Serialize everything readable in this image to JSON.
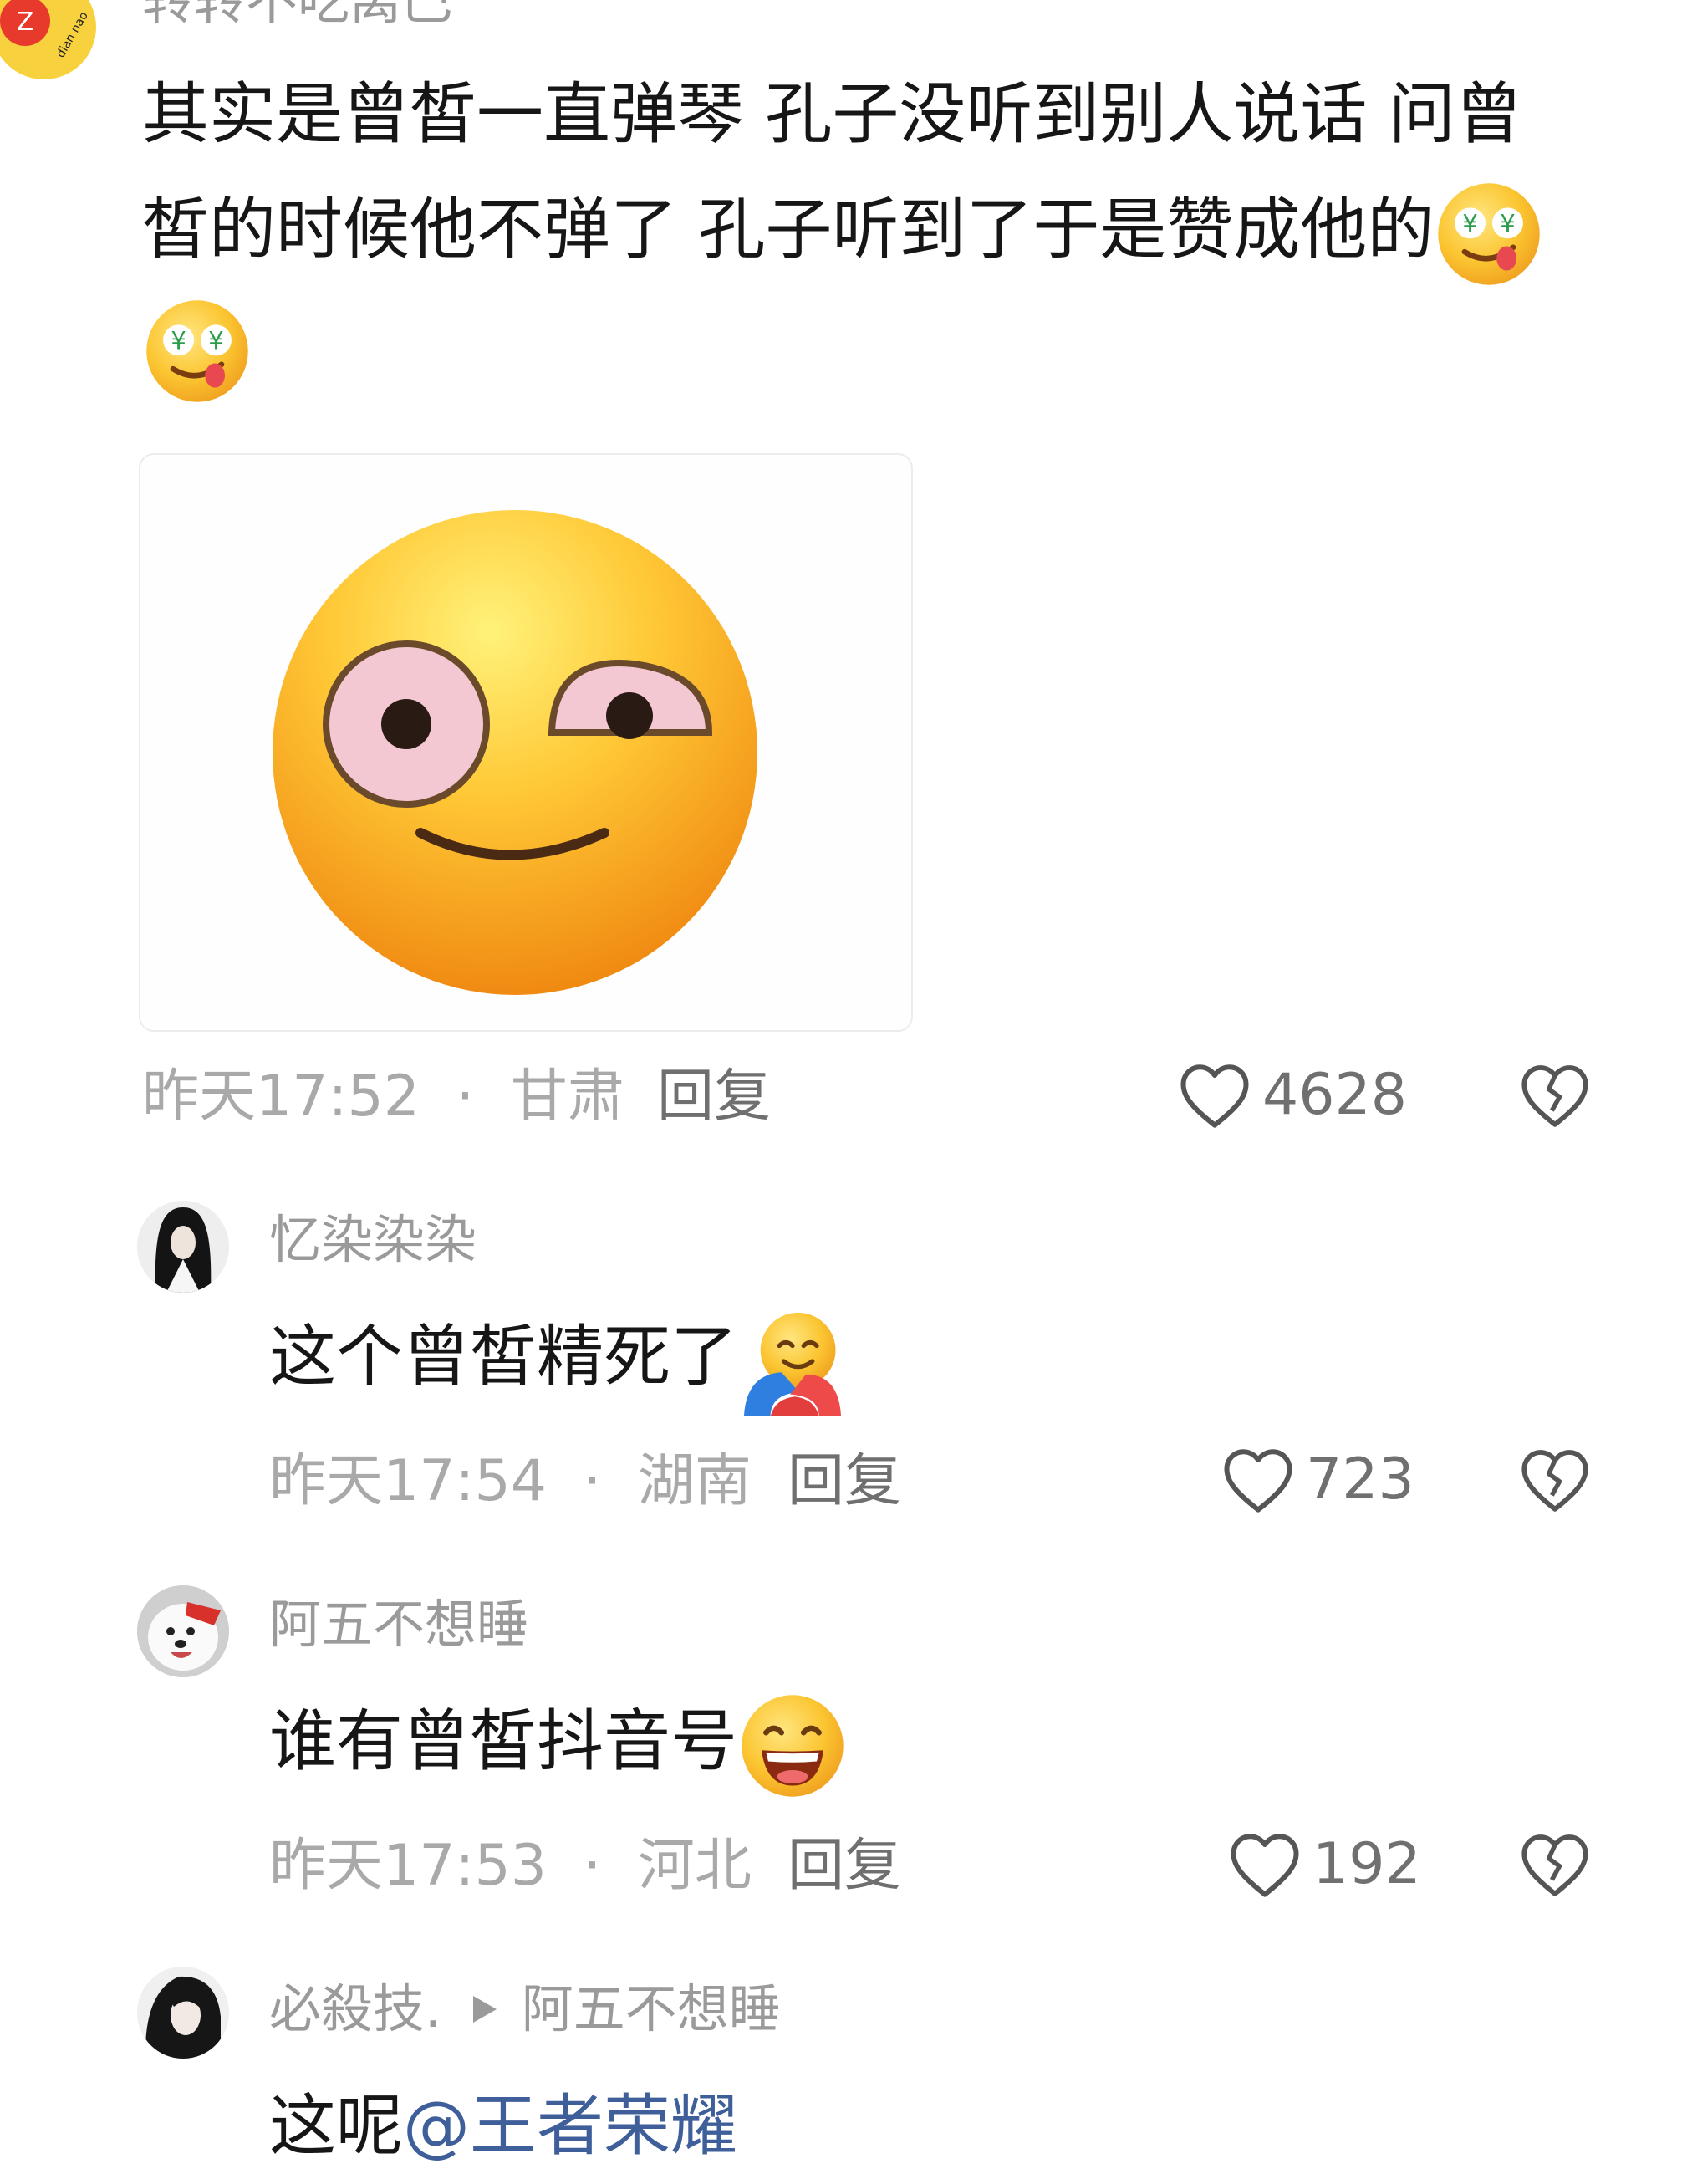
{
  "comments": [
    {
      "username": "转转不吃离巴",
      "avatar_text": "dian nao",
      "text_line1": "其实是曾皙一直弹琴 孔子没听到别人说话 问曾",
      "text_line2": "皙的时候他不弹了 孔子听到了于是赞成他的",
      "time": "昨天17:52",
      "location": "甘肃",
      "reply": "回复",
      "likes": "4628"
    },
    {
      "username": "忆染染染",
      "text": "这个曾皙精死了",
      "time": "昨天17:54",
      "location": "湖南",
      "reply": "回复",
      "likes": "723"
    },
    {
      "username": "阿五不想睡",
      "text": "谁有曾皙抖音号",
      "time": "昨天17:53",
      "location": "河北",
      "reply": "回复",
      "likes": "192"
    },
    {
      "username": "必殺技.",
      "reply_to": "阿五不想睡",
      "text_prefix": "这呢",
      "mention": "@王者荣耀"
    }
  ],
  "separator": "·",
  "icons": {
    "like": "heart-outline-icon",
    "dislike": "broken-heart-icon",
    "reply_arrow": "play-arrow-icon",
    "emoji_money_eyes": "money-eyes-tongue-emoji",
    "emoji_hug": "hugging-face-emoji",
    "emoji_grin": "grinning-face-emoji",
    "sticker": "pink-eyed-smirk-face"
  },
  "colors": {
    "text_primary": "#161616",
    "text_secondary": "#a9a9a9",
    "mention": "#3f5f9a",
    "emoji_yellow": "#f9c23c"
  }
}
